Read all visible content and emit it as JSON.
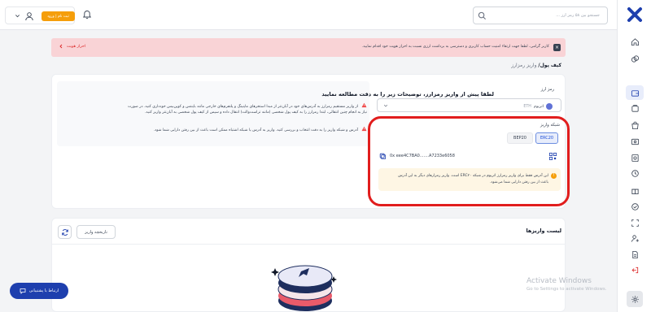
{
  "topbar": {
    "search_placeholder": "جستجو بین ۵۸ رمز ارز ...",
    "signup_label": "ثبت نام | ورود"
  },
  "alert": {
    "message": "کاربر گرامی، لطفا جهت ارتقاء امنیت حساب کاربری و دسترسی به برداشت ارزی نسبت به احراز هویت خود اقدام نمایید.",
    "action_label": "احراز هویت"
  },
  "breadcrumb": {
    "root": "کیف پول/",
    "current": "واریز رمزارز"
  },
  "info": {
    "title": "لطفا پیش از واریز رمزارز، توضیحات زیر را به دقت مطالعه نمایید",
    "line1": "از واریز مستقیم رمزارز به آدرس‌های خود در آبان‌تتر از مبدا استخرهای ماینینگ و پلتفرم‌های خارجی مانند بایننس و کوین‌بیس خودداری کنید. در صورت",
    "line2": "نیاز به انجام چنین انتقالی، ابتدا رمزارز را به کیف پول شخصی (مانند تراست‌والت) انتقال داده و سپس از کیف پول شخصی به آبان‌تتر واریز کنید.",
    "line3": "آدرس و شبکه واریز را به دقت انتخاب و بررسی کنید. واریز به آدرس یا شبکه اشتباه ممکن است باعث از بین رفتن دارایی شما شود."
  },
  "deposit": {
    "currency_label": "رمز ارز",
    "currency_value": "اتریوم",
    "currency_symbol": "ETH",
    "network_label": "شبکه واریز",
    "networks": [
      "ERC20",
      "BEP20"
    ],
    "selected_network": "ERC20",
    "address": "0x eee4C7BA0.......A7233e6058",
    "note": "این آدرس فقط برای واریز رمزارز اتریوم در شبکه ERC۲۰ است. واریز رمزارهای دیگر به این آدرس باعث از بین رفتن دارایی شما می‌شود."
  },
  "deposits_list": {
    "title": "لیست واریزها",
    "history_label": "تاریخچه واریز"
  },
  "support": {
    "label": "ارتباط با پشتیبانی"
  },
  "watermark": {
    "line1": "Activate Windows",
    "line2": "Go to Settings to activate Windows."
  },
  "colors": {
    "brand": "#1e3fae",
    "accent": "#f59e0b",
    "alert_bg": "#f9d3d6",
    "highlight_ring": "#e11d1d"
  },
  "icons": {
    "sidebar": [
      "home-icon",
      "exchange-icon",
      "wallet-icon",
      "trade-icon",
      "bag-icon",
      "card-icon",
      "convert-icon",
      "history-icon",
      "gift-icon",
      "verify-icon",
      "scan-icon",
      "user-plus-icon",
      "document-icon",
      "logout-icon",
      "gear-icon"
    ]
  }
}
